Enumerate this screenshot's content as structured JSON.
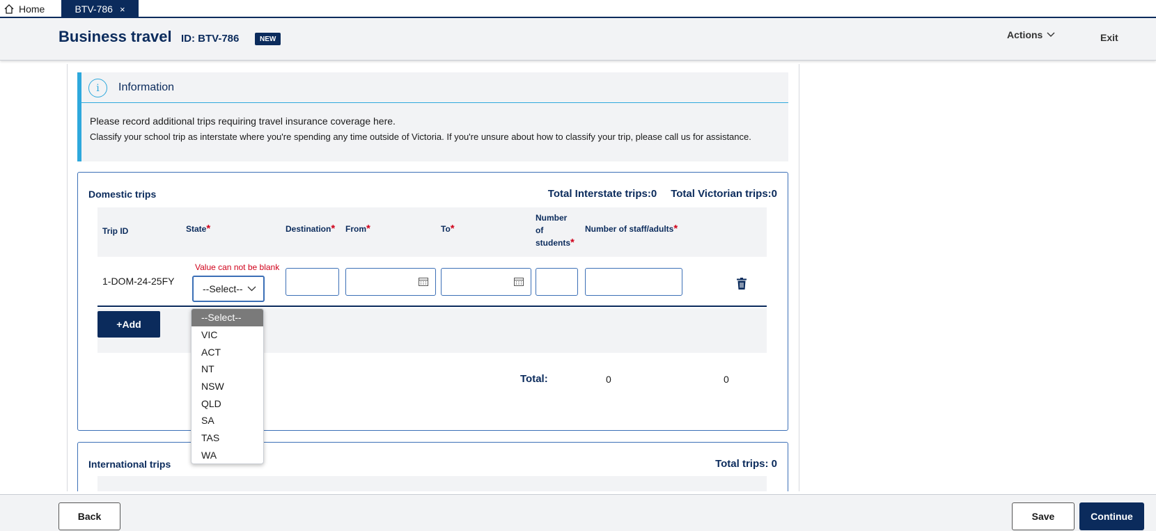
{
  "tabs": {
    "home_label": "Home",
    "active_label": "BTV-786",
    "close_glyph": "×"
  },
  "header": {
    "title": "Business travel",
    "record_id": "ID: BTV-786",
    "badge": "NEW",
    "actions_label": "Actions",
    "exit_label": "Exit"
  },
  "info": {
    "title": "Information",
    "icon_glyph": "i",
    "line1": "Please record additional trips requiring travel insurance coverage here.",
    "line2": "Classify your school trip as interstate where you're spending any time outside of Victoria. If you're unsure about how to classify your trip, please call us for assistance."
  },
  "domestic": {
    "title": "Domestic trips",
    "total_interstate_label": "Total Interstate trips:",
    "total_interstate_value": "0",
    "total_victorian_label": "Total Victorian trips:",
    "total_victorian_value": "0",
    "columns": {
      "trip_id": "Trip ID",
      "state": "State",
      "destination": "Destination",
      "from": "From",
      "to": "To",
      "students_1": "Number",
      "students_2": "of",
      "students_3": "students",
      "staff": "Number of staff/adults"
    },
    "required_mark": "*",
    "row": {
      "trip_id": "1-DOM-24-25FY",
      "state_error": "Value can not be blank",
      "state_value": "--Select--",
      "destination": "",
      "from": "",
      "to": "",
      "students": "",
      "staff": ""
    },
    "add_label": "+Add",
    "total_label": "Total:",
    "total_students": "0",
    "total_staff": "0"
  },
  "state_options": [
    "--Select--",
    "VIC",
    "ACT",
    "NT",
    "NSW",
    "QLD",
    "SA",
    "TAS",
    "WA"
  ],
  "international": {
    "title": "International trips",
    "total_label": "Total trips:",
    "total_value": "0"
  },
  "footer": {
    "back_label": "Back",
    "save_label": "Save",
    "continue_label": "Continue"
  },
  "colors": {
    "brand": "#0b2b5c",
    "accent": "#2ea8dc",
    "error": "#d0021b"
  }
}
